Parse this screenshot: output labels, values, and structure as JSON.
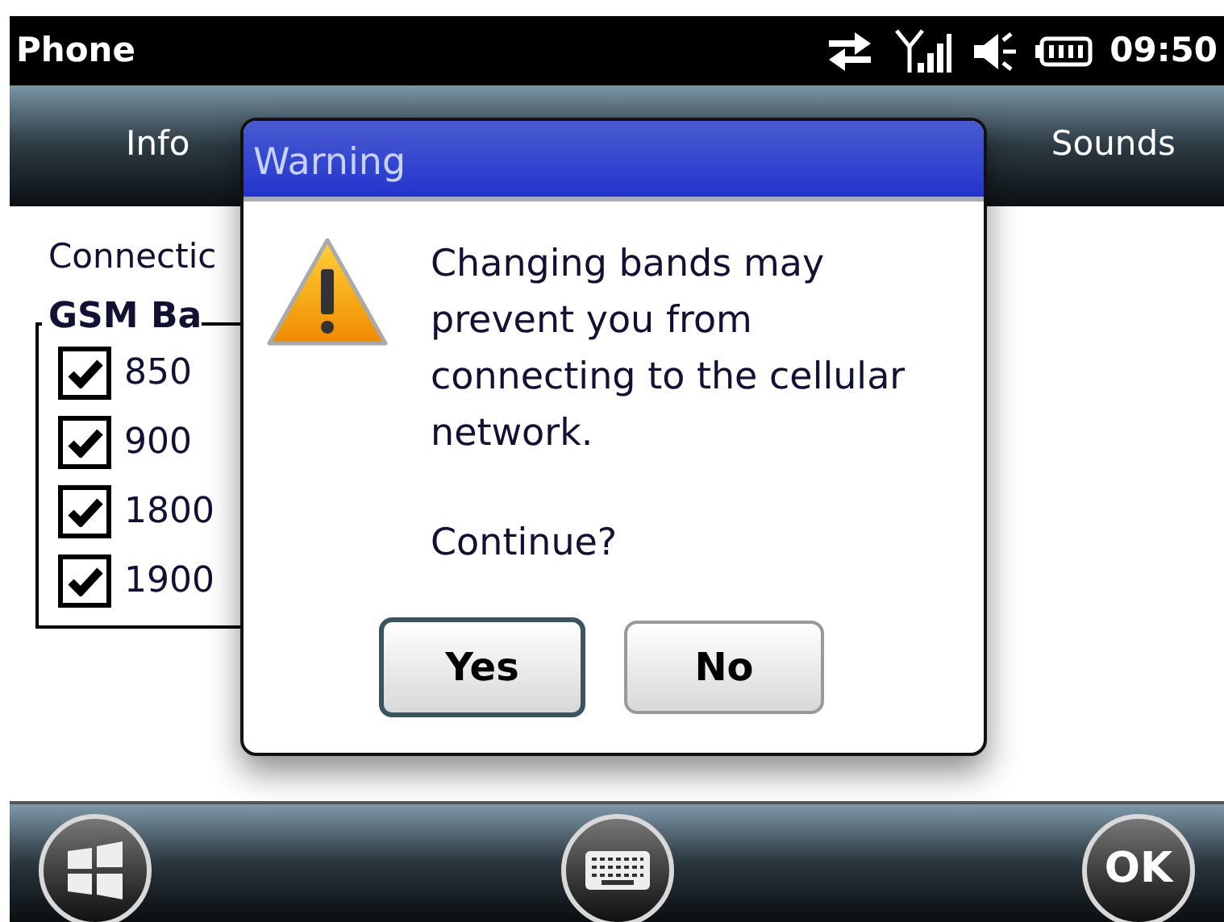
{
  "status_bar": {
    "title": "Phone",
    "time": "09:50"
  },
  "tabs": [
    {
      "label": "Info"
    },
    {
      "label": "Sounds"
    }
  ],
  "content": {
    "label": "Connectic",
    "group": {
      "title": "GSM Ba",
      "bands": [
        {
          "label": "850",
          "checked": true
        },
        {
          "label": "900",
          "checked": true
        },
        {
          "label": "1800",
          "checked": true
        },
        {
          "label": "1900",
          "checked": true
        }
      ]
    }
  },
  "dialog": {
    "title": "Warning",
    "message": "Changing bands may prevent you from connecting to the cellular network.",
    "question": "Continue?",
    "buttons": [
      {
        "label": "Yes",
        "focused": true
      },
      {
        "label": "No",
        "focused": false
      }
    ]
  },
  "softkeys": {
    "right": "OK"
  }
}
